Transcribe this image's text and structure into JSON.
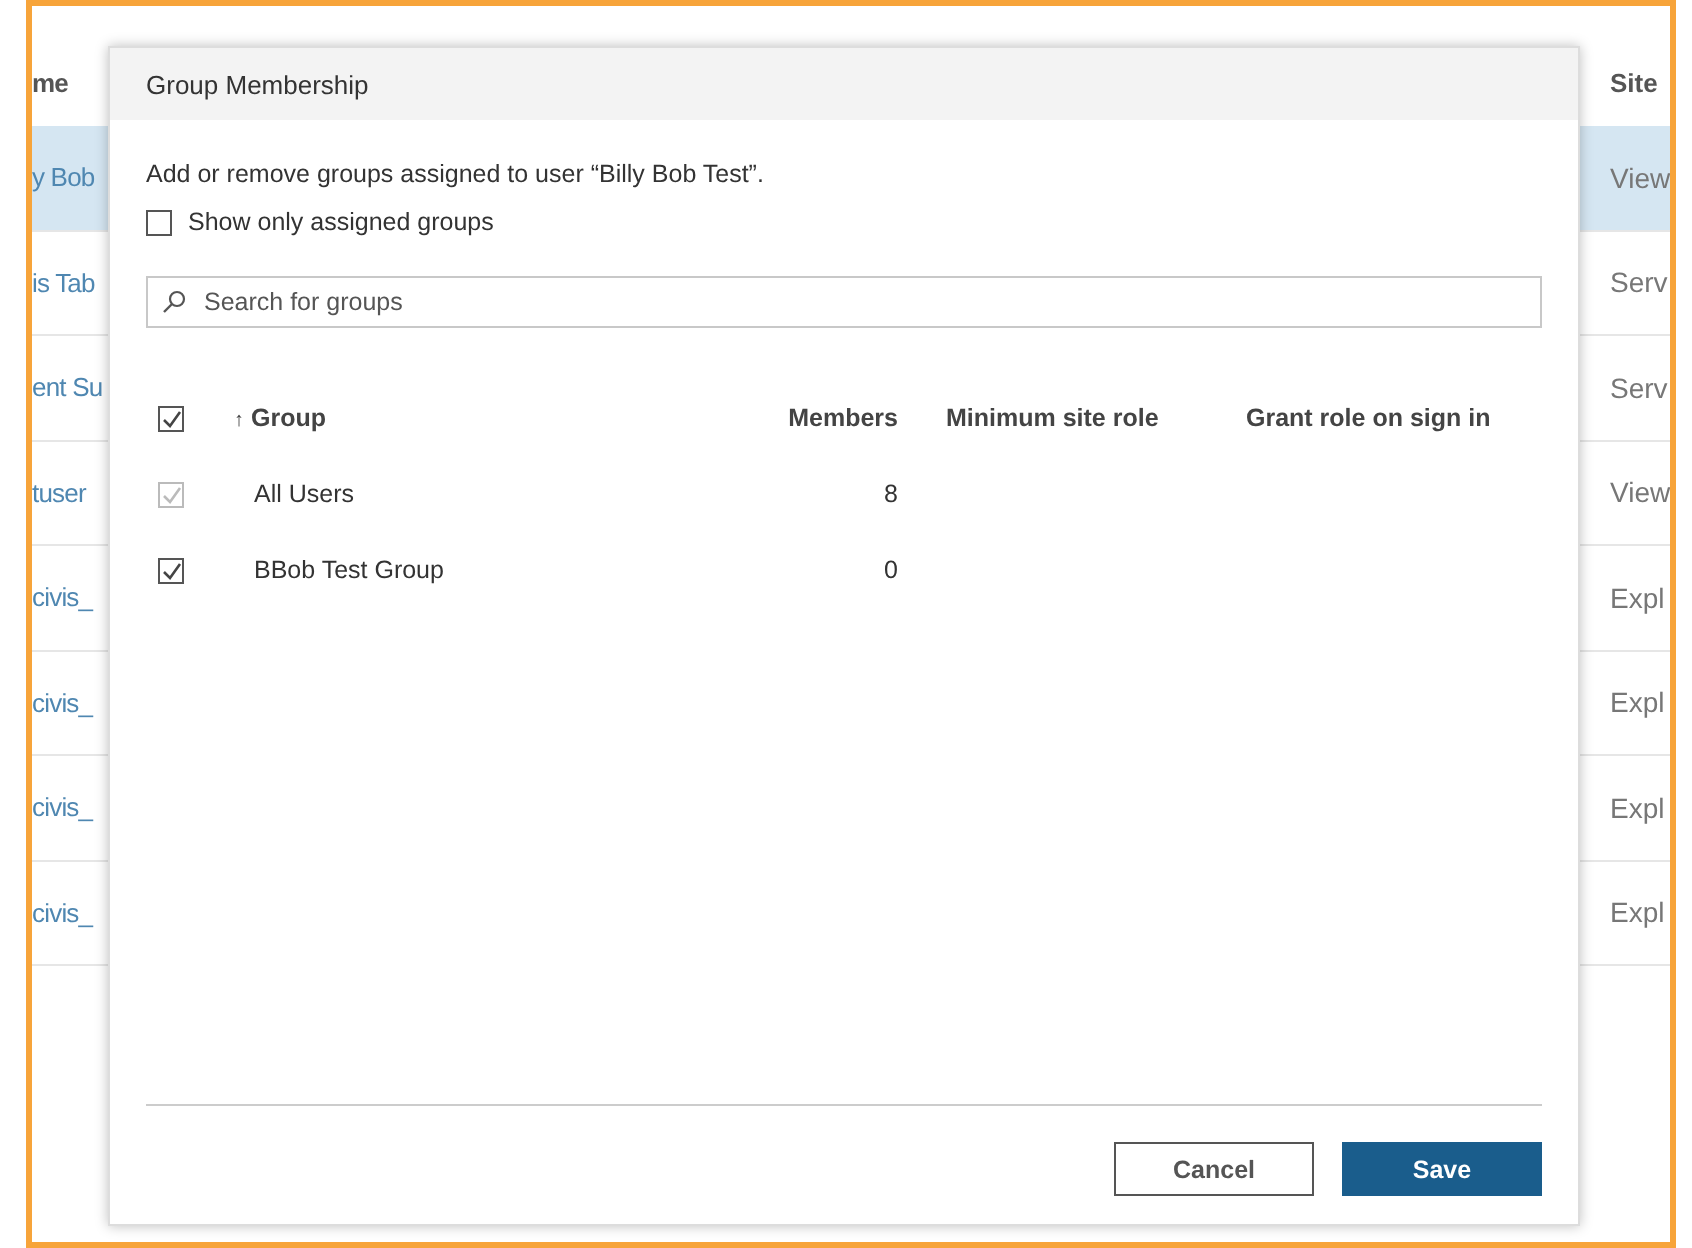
{
  "background_table": {
    "columns": [
      "me",
      "Site"
    ],
    "rows": [
      {
        "cells": [
          "y Bob",
          "View"
        ],
        "selected": true
      },
      {
        "cells": [
          "is Tab",
          "Serv"
        ],
        "selected": false
      },
      {
        "cells": [
          "ent Su",
          "Serv"
        ],
        "selected": false
      },
      {
        "cells": [
          "tuser",
          "View"
        ],
        "selected": false
      },
      {
        "cells": [
          "civis_",
          "Expl"
        ],
        "selected": false
      },
      {
        "cells": [
          "civis_",
          "Expl"
        ],
        "selected": false
      },
      {
        "cells": [
          "civis_",
          "Expl"
        ],
        "selected": false
      },
      {
        "cells": [
          "civis_",
          "Expl"
        ],
        "selected": false
      }
    ]
  },
  "dialog": {
    "title": "Group Membership",
    "description": "Add or remove groups assigned to user “Billy Bob Test”.",
    "filter": {
      "label": "Show only assigned groups",
      "checked": false
    },
    "search": {
      "placeholder": "Search for groups"
    },
    "table": {
      "select_all_checked": true,
      "sort_arrow": "↑",
      "columns": [
        "Group",
        "Members",
        "Minimum site role",
        "Grant role on sign in"
      ],
      "rows": [
        {
          "group": "All Users",
          "members": "8",
          "checked": true,
          "disabled": true
        },
        {
          "group": "BBob Test Group",
          "members": "0",
          "checked": true,
          "disabled": false
        }
      ]
    },
    "buttons": [
      {
        "label": "Cancel",
        "kind": "secondary"
      },
      {
        "label": "Save",
        "kind": "primary"
      }
    ]
  }
}
